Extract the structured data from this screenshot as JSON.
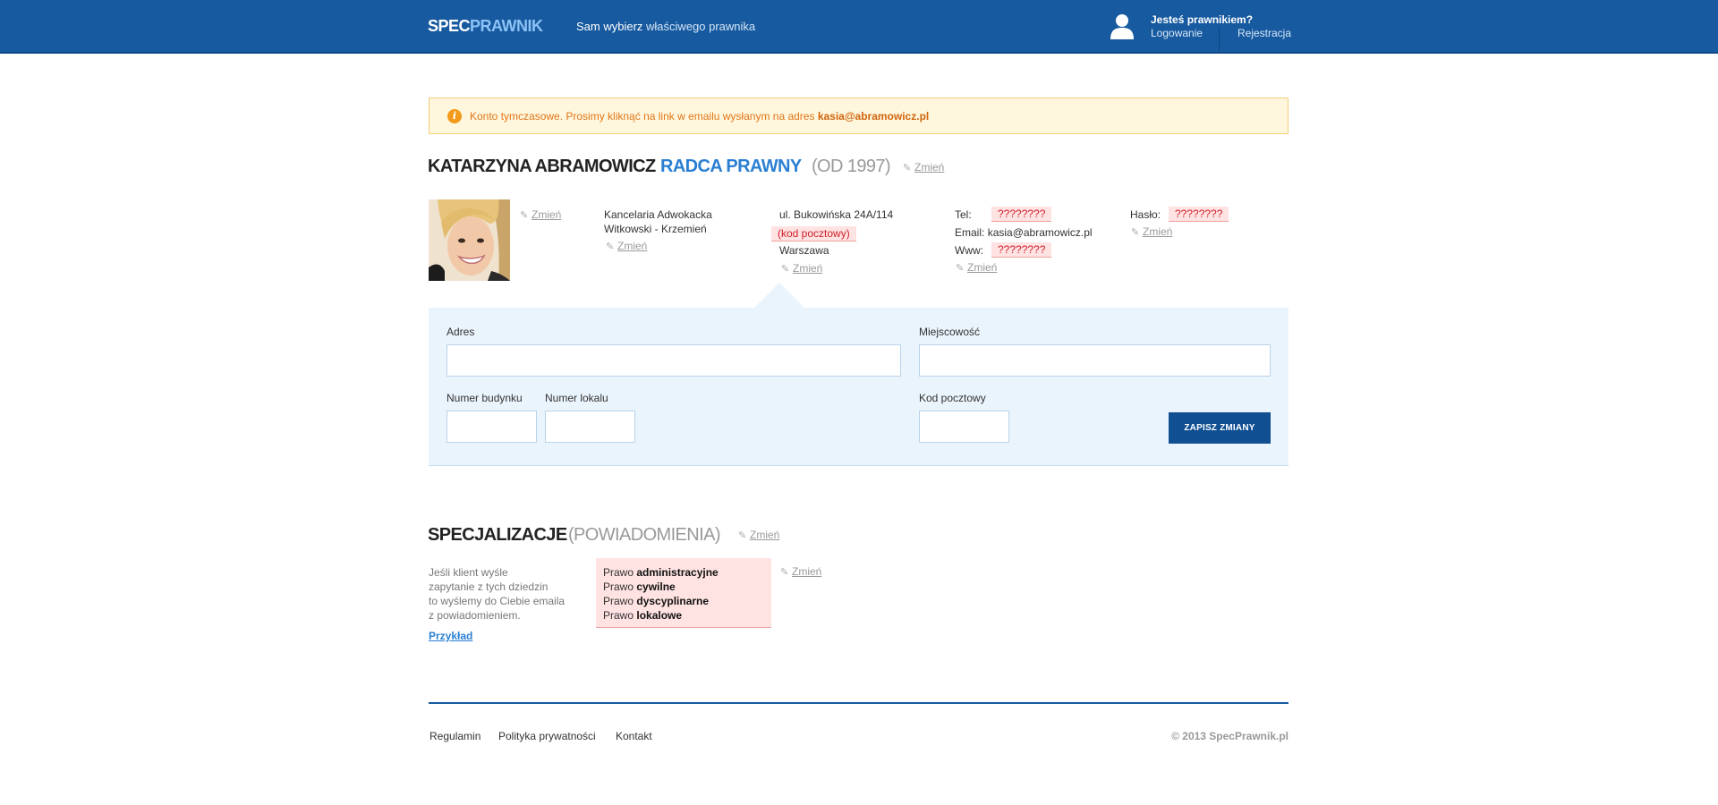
{
  "header": {
    "logo_part1": "SPEC",
    "logo_part2": "PRAWNIK",
    "tagline_bold": "Sam wybierz",
    "tagline_rest": " właściwego prawnika",
    "lawyer_question": "Jesteś prawnikiem?",
    "login": "Logowanie",
    "register": "Rejestracja"
  },
  "alert": {
    "text": "Konto tymczasowe. Prosimy kliknąć na link w emailu wysłanym na adres ",
    "email": "kasia@abramowicz.pl",
    "icon": "info-icon"
  },
  "profile": {
    "name": "KATARZYNA ABRAMOWICZ",
    "role": "RADCA PRAWNY",
    "since": "(OD 1997)",
    "edit_label": "Zmień",
    "office_line1": "Kancelaria Adwokacka",
    "office_line2": "Witkowski - Krzemień",
    "street": "ul. Bukowińska 24A/114",
    "postal_missing": "(kod pocztowy)",
    "city": "Warszawa",
    "tel_label": "Tel:",
    "tel_value": "????????",
    "email_label": "Email:",
    "email_value": "kasia@abramowicz.pl",
    "www_label": "Www:",
    "www_value": "????????",
    "password_label": "Hasło:",
    "password_value": "????????"
  },
  "form": {
    "address_label": "Adres",
    "city_label": "Miejscowość",
    "building_label": "Numer budynku",
    "unit_label": "Numer lokalu",
    "postal_label": "Kod pocztowy",
    "save_label": "ZAPISZ ZMIANY",
    "address_value": "",
    "city_value": "",
    "building_value": "",
    "unit_value": "",
    "postal_value": ""
  },
  "specializations": {
    "title": "SPECJALIZACJE",
    "subtitle": "(POWIADOMIENIA)",
    "edit_label": "Zmień",
    "desc_line1": "Jeśli klient wyśle",
    "desc_line2": "zapytanie z tych dziedzin",
    "desc_line3": "to wyślemy do Ciebie emaila",
    "desc_line4": "z powiadomieniem.",
    "example": "Przykład",
    "prefix": "Prawo ",
    "items": [
      "administracyjne",
      "cywilne",
      "dyscyplinarne",
      "lokalowe"
    ]
  },
  "footer": {
    "terms": "Regulamin",
    "privacy": "Polityka prywatności",
    "contact": "Kontakt",
    "copyright": "© 2013 SpecPrawnik.pl"
  },
  "colors": {
    "brand_blue": "#175aa0",
    "accent_blue": "#2a7fd3",
    "alert_orange": "#e0761a",
    "missing_red": "#d0202a"
  }
}
